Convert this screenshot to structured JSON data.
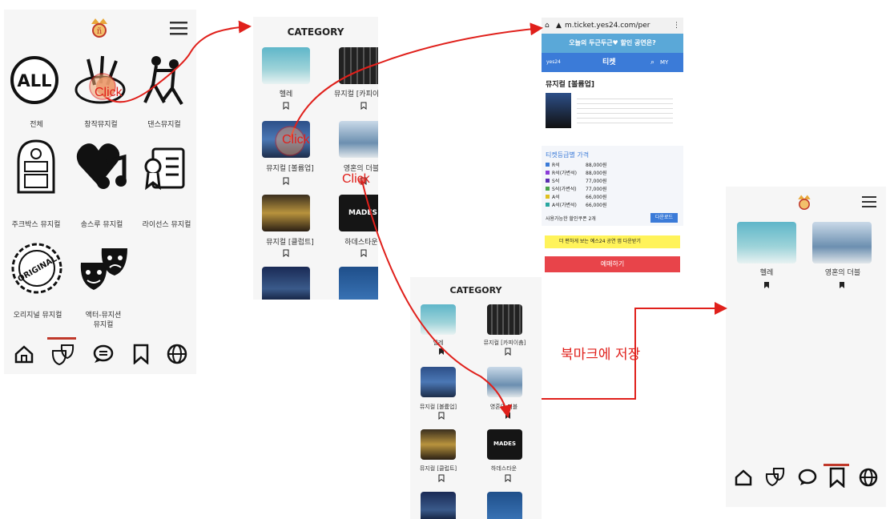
{
  "screen1": {
    "categories": [
      "전체",
      "창작뮤지컬",
      "댄스뮤지컬",
      "주크박스 뮤지컬",
      "송스루 뮤지컬",
      "라이선스 뮤지컬",
      "오리지널 뮤지컬",
      "액터-뮤지션\n뮤지컬"
    ],
    "all_badge": "ALL",
    "original_badge": "ORIGINAL"
  },
  "screen2": {
    "title": "CATEGORY",
    "items": [
      "헬레",
      "뮤지컬 [카피이춤]",
      "뮤지컬 [볼륨업]",
      "영혼의 더블",
      "뮤지컬 [클럽트]",
      "하데스타운"
    ],
    "poster_text": "MADES"
  },
  "screen3": {
    "url": "m.ticket.yes24.com/per",
    "banner": "오늘의 두근두근♥ 할인 공연은?",
    "tab": "티켓",
    "my": "MY",
    "title": "뮤지컬 [볼륨업]",
    "grade_title": "티켓등급별 가격",
    "prices": [
      {
        "seat": "R석",
        "price": "88,000원",
        "color": "#3b7bd8"
      },
      {
        "seat": "R석(가변석)",
        "price": "88,000원",
        "color": "#8a3bd8"
      },
      {
        "seat": "S석",
        "price": "77,000원",
        "color": "#5a2db0"
      },
      {
        "seat": "S석(가변석)",
        "price": "77,000원",
        "color": "#49a34a"
      },
      {
        "seat": "A석",
        "price": "66,000원",
        "color": "#e0c020"
      },
      {
        "seat": "A석(가변석)",
        "price": "66,000원",
        "color": "#2aa7a0"
      }
    ],
    "coupon_text": "사용가능한 할인쿠폰 2개",
    "coupon_button": "다운로드",
    "promo_text": "더 편하게 보는 예스24 공연 앱 다운받기",
    "reserve_button": "예매하기"
  },
  "screen4": {
    "title": "CATEGORY",
    "items": [
      "헬레",
      "뮤지컬 [카피이춤]",
      "뮤지컬 [볼륨업]",
      "영혼의 더블",
      "뮤지컬 [클럽트]",
      "하데스타운"
    ],
    "poster_text": "MADES"
  },
  "screen5": {
    "items": [
      "헬레",
      "영혼의 더블"
    ]
  },
  "annotations": {
    "click1": "Click",
    "click2": "Click",
    "click3": "Click",
    "save_bookmark": "북마크에 저장"
  },
  "colors": {
    "arrow": "#e0201b",
    "nav_active": "#c0392b"
  },
  "icons": [
    "crown-logo-icon",
    "hamburger-menu-icon",
    "home-icon",
    "theater-masks-icon",
    "chat-icon",
    "bookmark-icon",
    "globe-icon"
  ]
}
